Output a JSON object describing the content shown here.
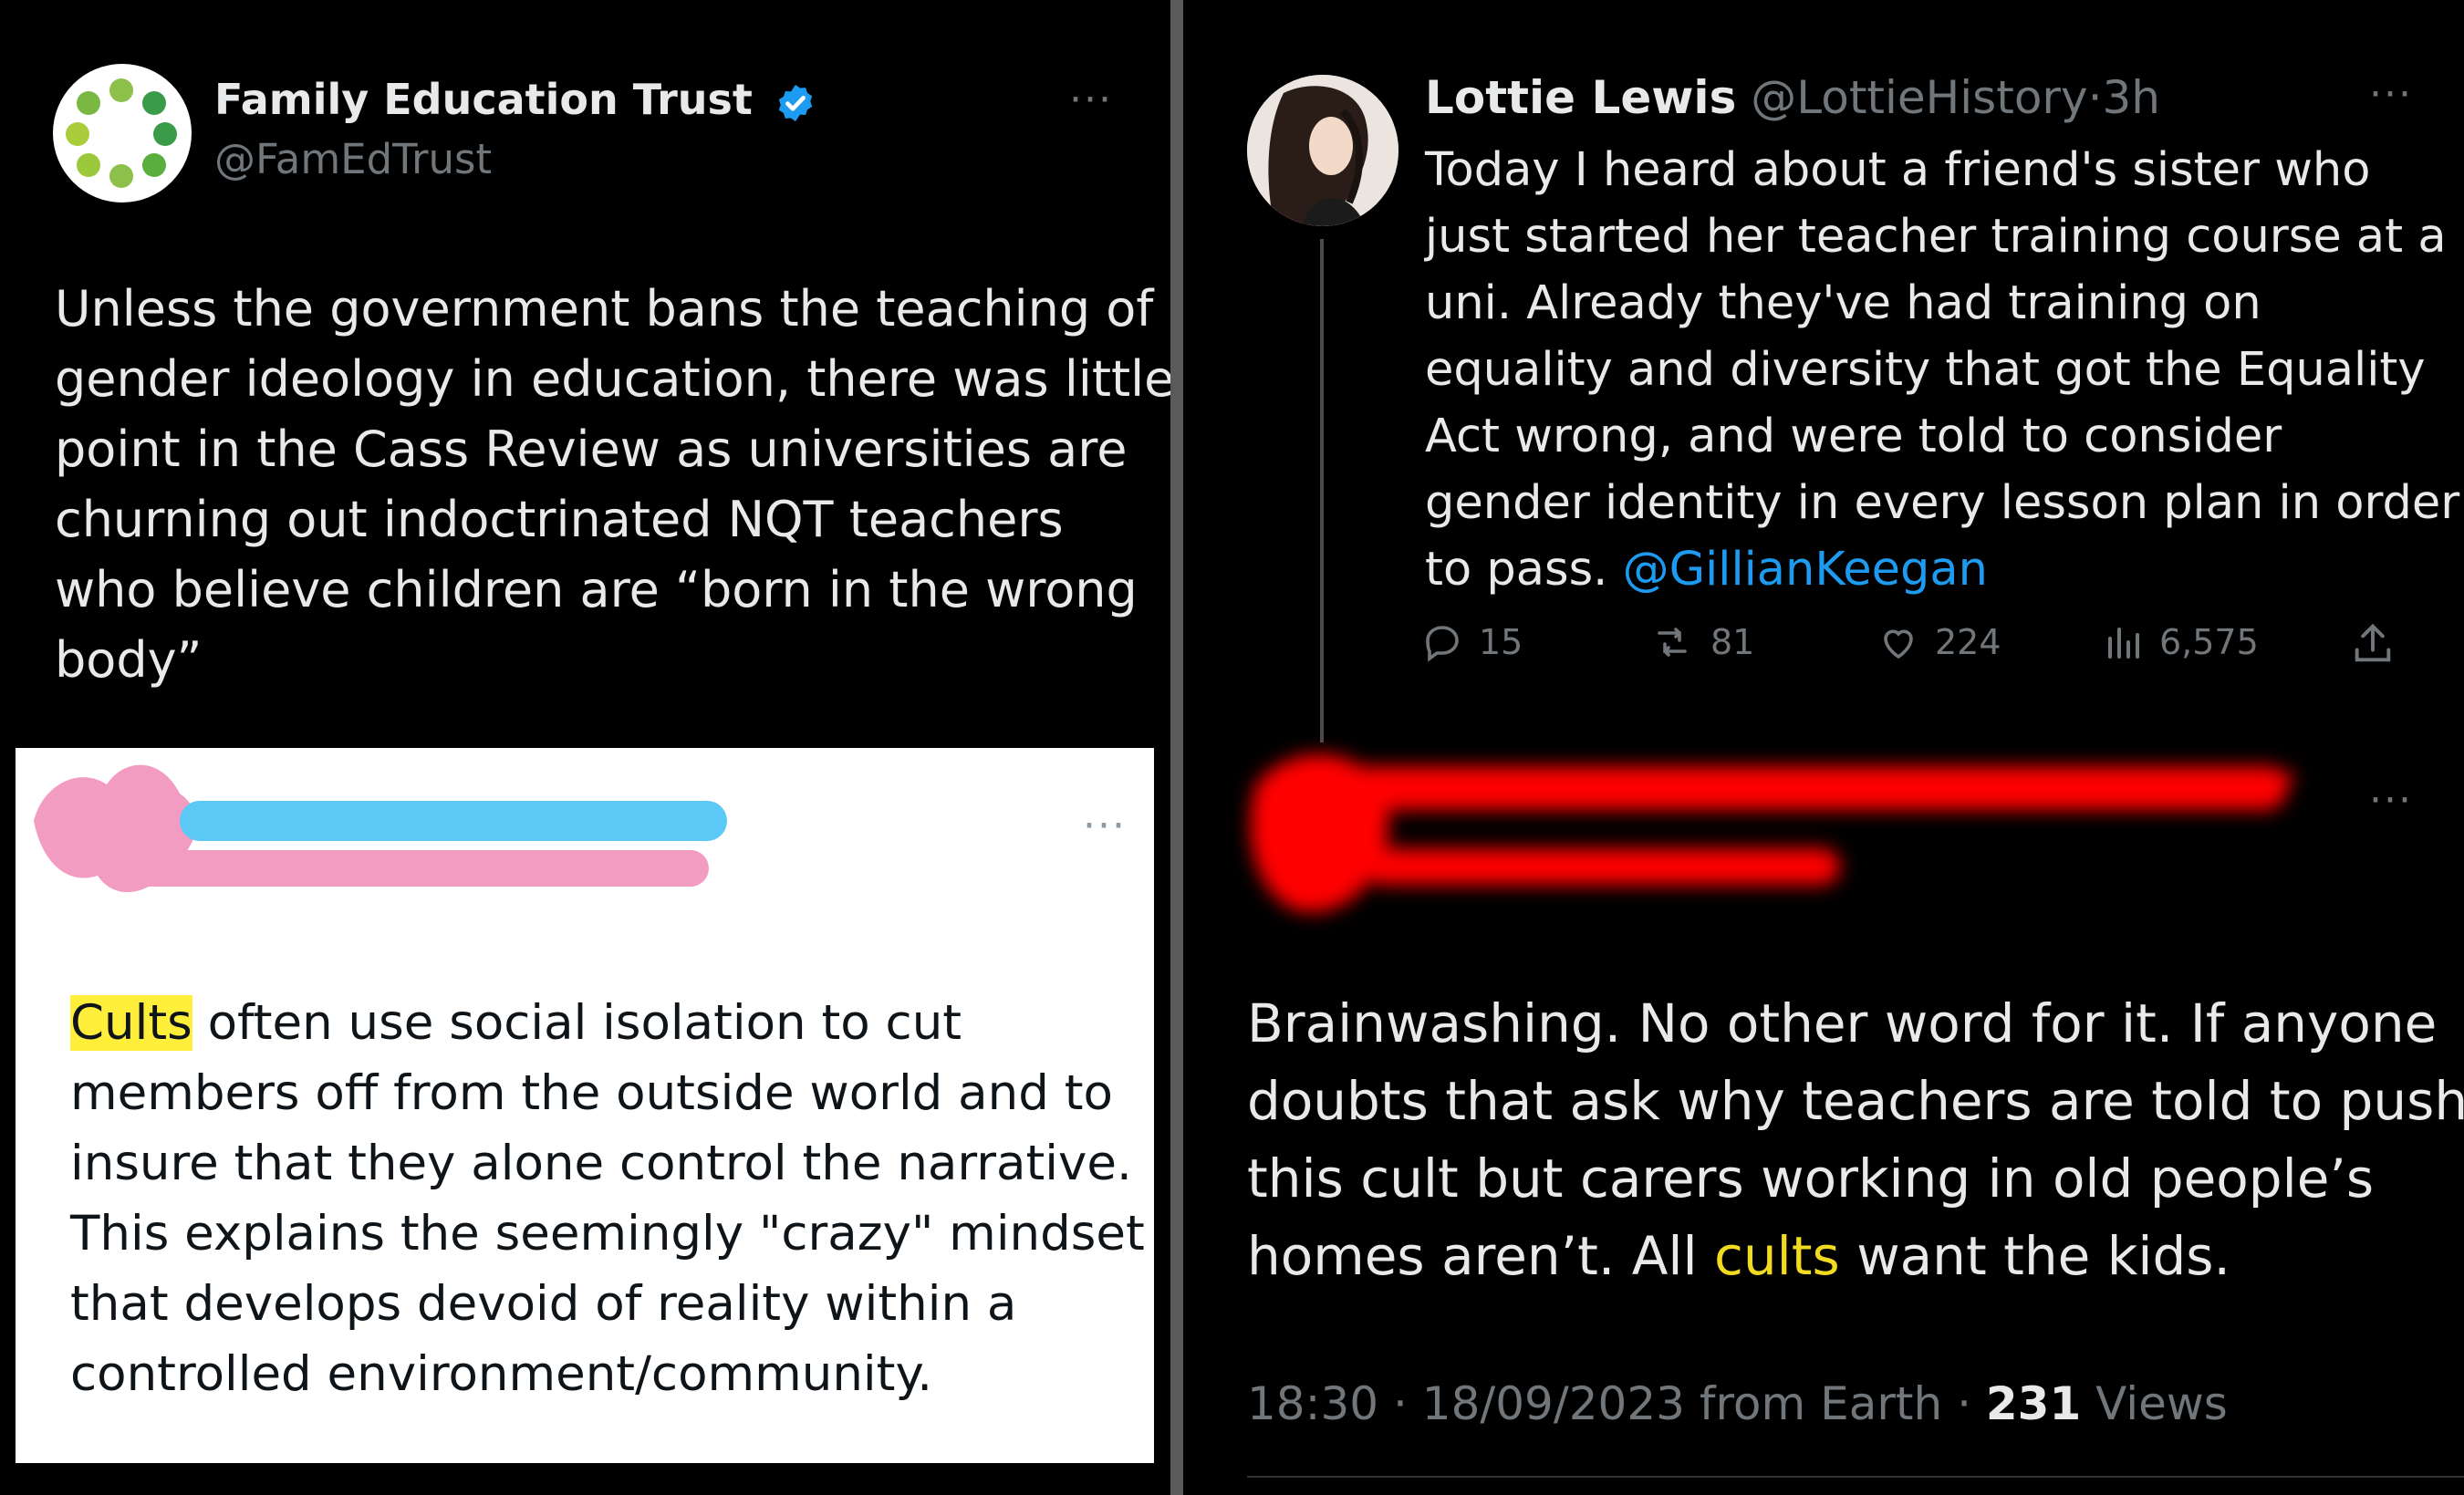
{
  "left_tweet": {
    "display_name": "Family Education Trust",
    "handle": "@FamEdTrust",
    "more_label": "···",
    "text_lines": [
      "Unless the government bans the teaching of",
      "gender ideology in education, there was little",
      "point in the Cass Review as universities are",
      "churning out indoctrinated NQT teachers",
      "who believe children are “born in the wrong",
      "body”"
    ]
  },
  "quoted_card": {
    "more_label": "···",
    "highlighted_word": "Cults",
    "first_line_rest": " often use social isolation to cut",
    "text_lines": [
      "members off from the outside world and to",
      "insure that they alone control the narrative.",
      "This explains the seemingly \"crazy\" mindset",
      "that develops devoid of reality within a",
      "controlled environment/community."
    ]
  },
  "right_tweet": {
    "display_name": "Lottie Lewis",
    "handle": "@LottieHistory",
    "separator": "·",
    "time": "3h",
    "more_label": "···",
    "text_lines": [
      "Today I heard about a friend's sister who",
      "just started her teacher training course at a",
      "uni. Already they've had training on",
      "equality and diversity that got the Equality",
      "Act wrong, and were told to consider",
      "gender identity in every lesson plan in order"
    ],
    "last_line_prefix": "to pass. ",
    "mention": "@GillianKeegan",
    "replies": "15",
    "retweets": "81",
    "likes": "224",
    "views": "6,575"
  },
  "reply_tweet": {
    "more_label": "···",
    "text_lines": [
      "Brainwashing. No other word for it. If anyone",
      "doubts that ask why teachers are told to push",
      "this cult but carers working in old people’s"
    ],
    "last_line_prefix": "homes aren’t. All ",
    "highlighted_word": "cults",
    "last_line_suffix": " want the kids.",
    "footer_meta": "18:30 · 18/09/2023 from Earth · ",
    "views_count": "231",
    "views_label": " Views"
  },
  "colors": {
    "background": "#000000",
    "text": "#e7e9ea",
    "secondary": "#71767b",
    "link": "#1d9bf0",
    "highlight_yellow": "#ffef3b",
    "yellow_word": "#f1da1f",
    "redaction_red": "#ff0000"
  }
}
